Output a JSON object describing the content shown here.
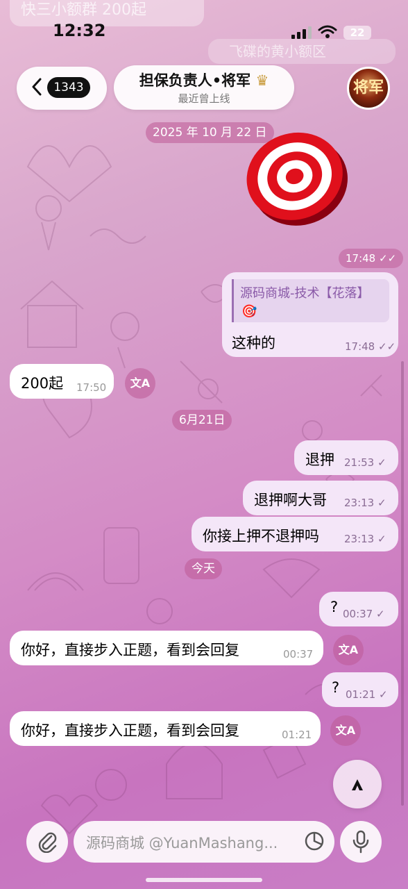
{
  "status_bar": {
    "time": "12:32",
    "battery": "22",
    "notification_behind": "快三小额群 200起",
    "notification_behind2": "飞碟的黄小额区"
  },
  "header": {
    "back_count": "1343",
    "title": "担保负责人•将军",
    "subtitle": "最近曾上线",
    "avatar_text": "将军"
  },
  "dates": {
    "d1": "2025 年 10 月 22 日",
    "d2": "6月21日",
    "d3": "今天"
  },
  "messages": [
    {
      "id": "m1",
      "side": "out",
      "type": "sticker",
      "time": "17:48"
    },
    {
      "id": "m2",
      "side": "out",
      "reply_name": "源码商城-技术【花落】",
      "reply_icon": "🎯",
      "text": "这种的",
      "time": "17:48"
    },
    {
      "id": "m3",
      "side": "in",
      "text": "200起",
      "time": "17:50"
    },
    {
      "id": "m4",
      "side": "out",
      "text": "退押",
      "time": "21:53"
    },
    {
      "id": "m5",
      "side": "out",
      "text": "退押啊大哥",
      "time": "23:13"
    },
    {
      "id": "m6",
      "side": "out",
      "text": "你接上押不退押吗",
      "time": "23:13"
    },
    {
      "id": "m7",
      "side": "out",
      "text": "?",
      "time": "00:37"
    },
    {
      "id": "m8",
      "side": "in",
      "text": "你好，直接步入正题，看到会回复",
      "time": "00:37"
    },
    {
      "id": "m9",
      "side": "out",
      "text": "?",
      "time": "01:21"
    },
    {
      "id": "m10",
      "side": "in",
      "text": "你好，直接步入正题，看到会回复",
      "time": "01:21"
    }
  ],
  "translate_label": "文A",
  "input": {
    "placeholder": "源码商城 @YuanMashang..."
  },
  "colors": {
    "accent": "#be5a96",
    "out_bubble": "#f4e6f8",
    "in_bubble": "#ffffff"
  }
}
